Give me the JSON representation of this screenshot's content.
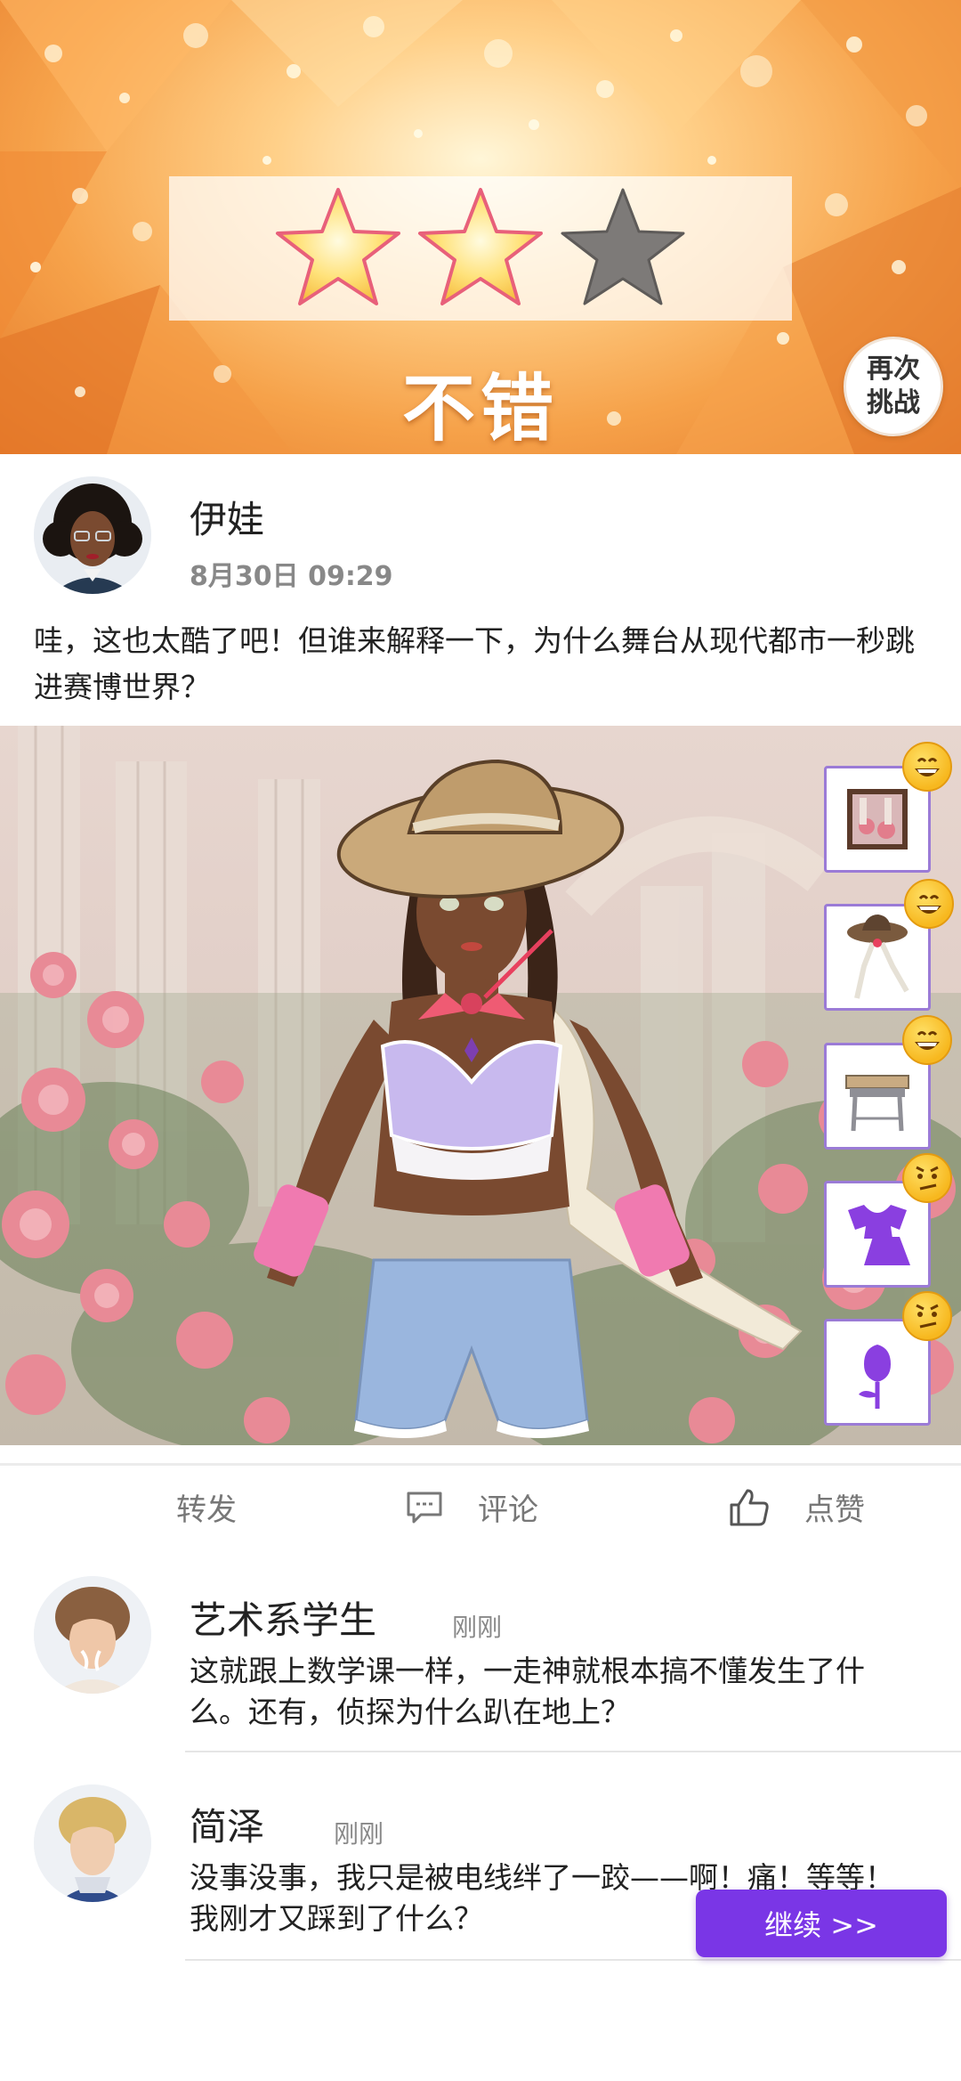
{
  "result": {
    "stars_earned": 2,
    "stars_total": 3,
    "rating_label": "不错",
    "retry_label": "再次挑战"
  },
  "post": {
    "author": "伊娃",
    "time": "8月30日 09:29",
    "text": "哇，这也太酷了吧！但谁来解释一下，为什么舞台从现代都市一秒跳进赛博世界？"
  },
  "items": [
    {
      "icon": "background-scene-icon",
      "reaction": "grin"
    },
    {
      "icon": "hat-outfit-icon",
      "reaction": "grin"
    },
    {
      "icon": "school-desk-icon",
      "reaction": "grin"
    },
    {
      "icon": "clothing-top-icon",
      "reaction": "confused"
    },
    {
      "icon": "rose-accessory-icon",
      "reaction": "confused"
    }
  ],
  "actions": {
    "share": "转发",
    "comment": "评论",
    "like": "点赞"
  },
  "comments": [
    {
      "name": "艺术系学生",
      "time": "刚刚",
      "text": "这就跟上数学课一样，一走神就根本搞不懂发生了什么。还有，侦探为什么趴在地上？"
    },
    {
      "name": "简泽",
      "time": "刚刚",
      "text": "没事没事，我只是被电线绊了一跤——啊！痛！等等！我刚才又踩到了什么？"
    }
  ],
  "continue_label": "继续 >>",
  "colors": {
    "accent": "#7a36e6",
    "star_gold": "#ffd54a",
    "star_grey": "#7d7a78",
    "item_border": "#9b7bd6"
  }
}
